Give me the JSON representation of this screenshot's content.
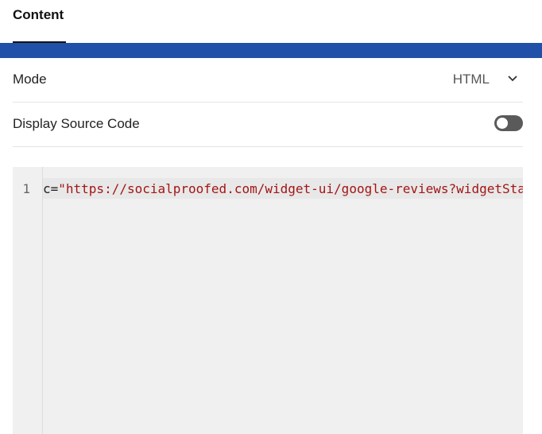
{
  "tabs": [
    {
      "label": "Content"
    }
  ],
  "fields": {
    "mode": {
      "label": "Mode",
      "value": "HTML"
    },
    "display_source_code": {
      "label": "Display Source Code",
      "enabled": false
    }
  },
  "editor": {
    "line_number": "1",
    "code_prefix": "c=",
    "code_string": "\"https://socialproofed.com/widget-ui/google-reviews?widgetSta"
  },
  "colors": {
    "accent_bar": "#2150a8",
    "toggle_off": "#5a5a5a",
    "code_string": "#a31515"
  },
  "icons": {
    "mode_dropdown": "chevron-down-icon"
  }
}
